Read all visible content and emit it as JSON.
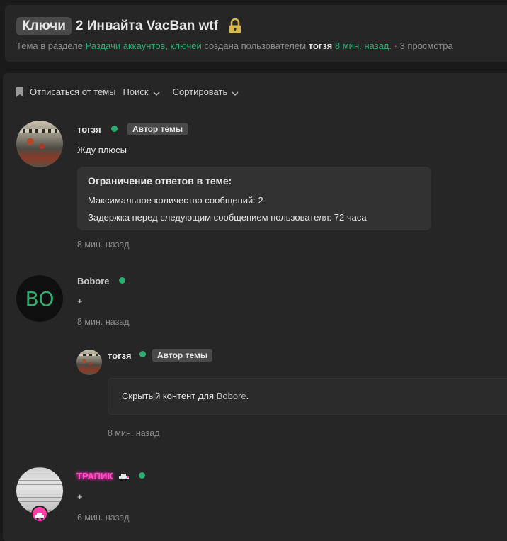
{
  "header": {
    "prefix": "Ключи",
    "title": "2 Инвайта VacBan wtf",
    "meta": {
      "part1": "Тема в разделе",
      "section": "Раздачи аккаунтов, ключей",
      "part2": "создана пользователем",
      "author": "тогзя",
      "time": "8 мин. назад.",
      "views": "· 3 просмотра"
    }
  },
  "actions": {
    "unsubscribe": "Отписаться от темы",
    "search": "Поиск",
    "sort": "Сортировать"
  },
  "posts": [
    {
      "username": "тогзя",
      "badge": "Автор темы",
      "text": "Жду плюсы",
      "restriction": {
        "title": "Ограничение ответов в теме:",
        "line1": "Максимальное количество сообщений: 2",
        "line2": "Задержка перед следующим сообщением пользователя: 72 часа"
      },
      "time": "8 мин. назад"
    },
    {
      "avatar_letters": "BO",
      "username": "Bobore",
      "text": "+",
      "time": "8 мин. назад",
      "reply": {
        "username": "тогзя",
        "badge": "Автор темы",
        "hidden_prefix": "Скрытый контент для",
        "hidden_mention": "Bobore",
        "hidden_suffix": ".",
        "time": "8 мин. назад"
      }
    },
    {
      "username": "ТРАПИК",
      "text": "+",
      "time": "6 мин. назад"
    }
  ],
  "colors": {
    "accent_green": "#2bad72",
    "background": "#1a1a1a",
    "panel": "#262626",
    "nick_pink": "#ff4fc8"
  },
  "icons": [
    "lock-icon",
    "bookmark-icon",
    "chevron-down-icon",
    "online-indicator",
    "car-icon"
  ]
}
